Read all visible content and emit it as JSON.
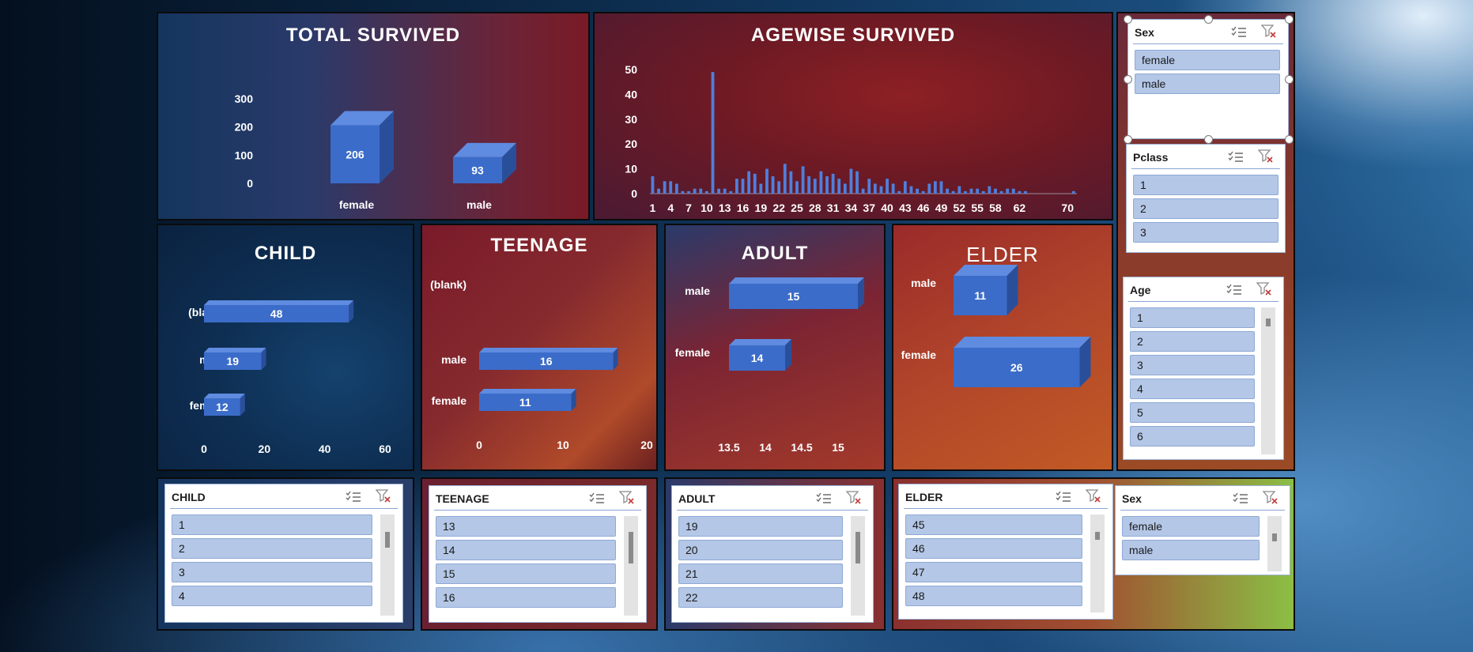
{
  "colors": {
    "bar": "#3b6cc9",
    "bar_top": "#5f8be0",
    "bar_side": "#2a4f9a",
    "axis_text": "#ffffff"
  },
  "titles": {
    "total_survived": "TOTAL SURVIVED",
    "agewise_survived": "AGEWISE SURVIVED",
    "child": "CHILD",
    "teenage": "TEENAGE",
    "adult": "ADULT",
    "elder": "ELDER"
  },
  "chart_data": [
    {
      "id": "total",
      "type": "bar",
      "title": "TOTAL SURVIVED",
      "categories": [
        "female",
        "male"
      ],
      "values": [
        206,
        93
      ],
      "ylim": [
        0,
        300
      ],
      "yticks": [
        0,
        100,
        200,
        300
      ],
      "data_labels": true
    },
    {
      "id": "agewise",
      "type": "bar",
      "title": "AGEWISE SURVIVED",
      "categories": [
        1,
        2,
        3,
        4,
        5,
        6,
        7,
        8,
        9,
        10,
        11,
        12,
        13,
        14,
        15,
        16,
        17,
        18,
        19,
        20,
        21,
        22,
        23,
        24,
        25,
        26,
        27,
        28,
        29,
        30,
        31,
        32,
        33,
        34,
        35,
        36,
        37,
        38,
        39,
        40,
        41,
        42,
        43,
        44,
        45,
        46,
        47,
        48,
        49,
        50,
        51,
        52,
        53,
        54,
        55,
        56,
        57,
        58,
        59,
        60,
        61,
        62,
        63,
        64,
        65,
        66,
        67,
        68,
        69,
        70,
        71
      ],
      "values": [
        7,
        2,
        5,
        5,
        4,
        1,
        1,
        2,
        2,
        1,
        49,
        2,
        2,
        1,
        6,
        6,
        9,
        8,
        4,
        10,
        7,
        5,
        12,
        9,
        5,
        11,
        7,
        6,
        9,
        7,
        8,
        6,
        4,
        10,
        9,
        2,
        6,
        4,
        3,
        6,
        4,
        1,
        5,
        3,
        2,
        1,
        4,
        5,
        5,
        2,
        1,
        3,
        1,
        2,
        2,
        1,
        3,
        2,
        1,
        2,
        2,
        1,
        1,
        0,
        0,
        0,
        0,
        0,
        0,
        0,
        1
      ],
      "xticks": [
        1,
        4,
        7,
        10,
        13,
        16,
        19,
        22,
        25,
        28,
        31,
        34,
        37,
        40,
        43,
        46,
        49,
        52,
        55,
        58,
        62,
        70
      ],
      "ylim": [
        0,
        50
      ],
      "yticks": [
        0,
        10,
        20,
        30,
        40,
        50
      ]
    },
    {
      "id": "child",
      "type": "bar",
      "orientation": "horizontal",
      "title": "CHILD",
      "categories": [
        "(blank)",
        "male",
        "female"
      ],
      "values": [
        48,
        19,
        12
      ],
      "xlim": [
        0,
        60
      ],
      "xticks": [
        0,
        20,
        40,
        60
      ],
      "data_labels": true
    },
    {
      "id": "teenage",
      "type": "bar",
      "orientation": "horizontal",
      "title": "TEENAGE",
      "categories": [
        "(blank)",
        "male",
        "female"
      ],
      "values": [
        null,
        16,
        11
      ],
      "xlim": [
        0,
        20
      ],
      "xticks": [
        0,
        10,
        20
      ],
      "data_labels": true
    },
    {
      "id": "adult",
      "type": "bar",
      "orientation": "horizontal",
      "title": "ADULT",
      "categories": [
        "male",
        "female"
      ],
      "values": [
        15,
        14
      ],
      "xlim": [
        13.5,
        15
      ],
      "xticks": [
        "13.5",
        "14",
        "14.5",
        "15"
      ],
      "data_labels": true
    },
    {
      "id": "elder",
      "type": "bar",
      "orientation": "horizontal",
      "title": "ELDER",
      "categories": [
        "male",
        "female"
      ],
      "values": [
        11,
        26
      ],
      "xlim": [
        0,
        30
      ],
      "data_labels": true
    }
  ],
  "slicers": {
    "sex_top": {
      "title": "Sex",
      "items": [
        "female",
        "male"
      ]
    },
    "pclass": {
      "title": "Pclass",
      "items": [
        "1",
        "2",
        "3"
      ]
    },
    "age": {
      "title": "Age",
      "items": [
        "1",
        "2",
        "3",
        "4",
        "5",
        "6"
      ]
    },
    "child": {
      "title": "CHILD",
      "items": [
        "1",
        "2",
        "3",
        "4"
      ]
    },
    "teenage": {
      "title": "TEENAGE",
      "items": [
        "13",
        "14",
        "15",
        "16"
      ]
    },
    "adult": {
      "title": "ADULT",
      "items": [
        "19",
        "20",
        "21",
        "22"
      ]
    },
    "elder": {
      "title": "ELDER",
      "items": [
        "45",
        "46",
        "47",
        "48"
      ]
    },
    "sex_bottom": {
      "title": "Sex",
      "items": [
        "female",
        "male"
      ]
    }
  },
  "icons": {
    "multiselect": "multi-select-icon",
    "clear_filter": "clear-filter-icon"
  }
}
